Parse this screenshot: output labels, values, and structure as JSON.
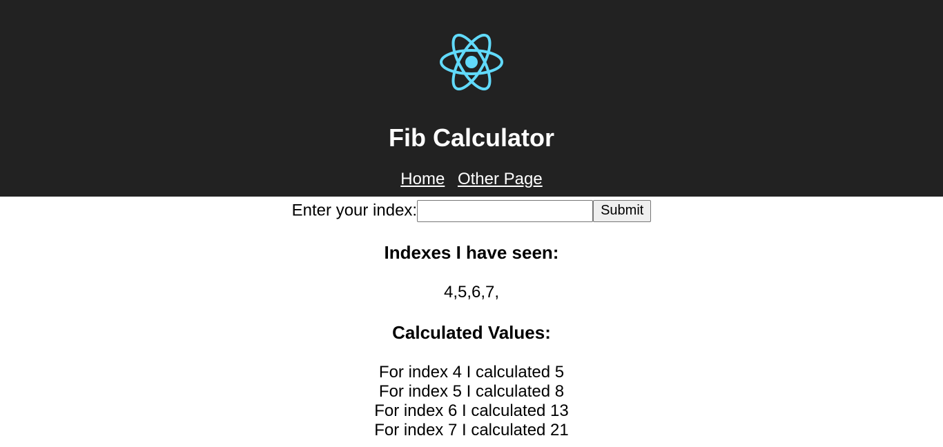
{
  "header": {
    "logo_icon": "react-atom-icon",
    "logo_color": "#61dafb",
    "background": "#222222",
    "title": "Fib Calculator",
    "nav": [
      {
        "label": "Home"
      },
      {
        "label": "Other Page"
      }
    ]
  },
  "form": {
    "label": "Enter your index:",
    "input_value": "",
    "submit_label": "Submit"
  },
  "seen": {
    "heading": "Indexes I have seen:",
    "values": "4,5,6,7,"
  },
  "calculated": {
    "heading": "Calculated Values:",
    "items": [
      "For index 4 I calculated 5",
      "For index 5 I calculated 8",
      "For index 6 I calculated 13",
      "For index 7 I calculated 21"
    ]
  }
}
